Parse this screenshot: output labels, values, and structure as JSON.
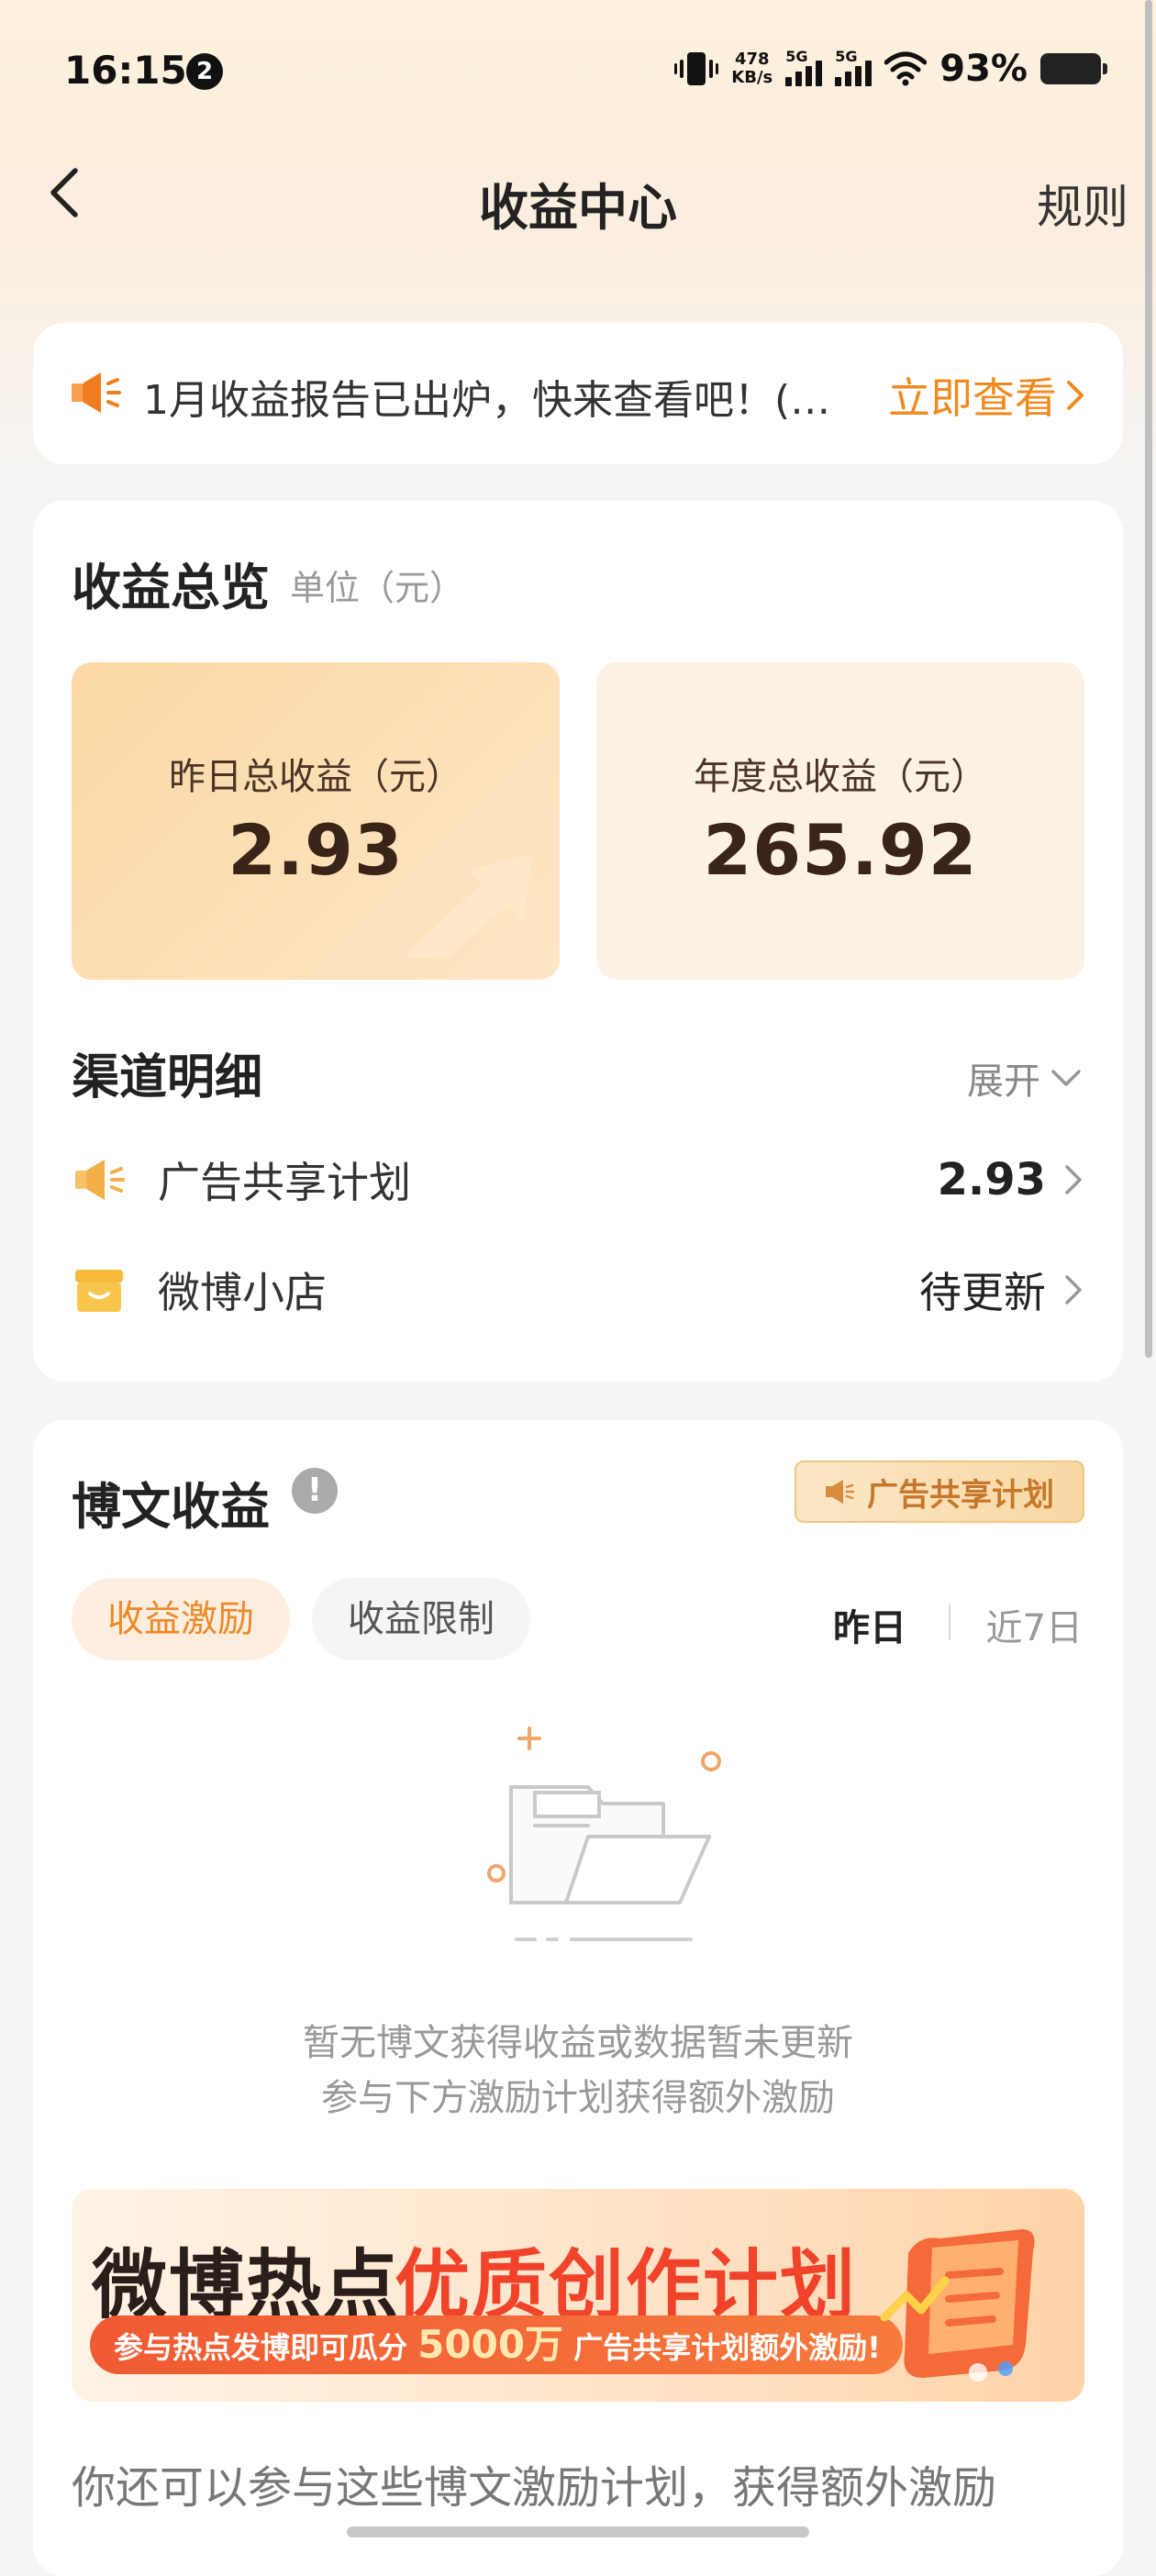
{
  "status_bar": {
    "time": "16:15",
    "notification_count": "2",
    "net_speed_value": "478",
    "net_speed_unit": "KB/s",
    "sim1_label": "5G",
    "sim2_label": "5G",
    "battery": "93%"
  },
  "nav": {
    "title": "收益中心",
    "rules": "规则"
  },
  "notice": {
    "text": "1月收益报告已出炉，快来查看吧！(…",
    "link": "立即查看"
  },
  "overview": {
    "title": "收益总览",
    "unit": "单位（元）",
    "stats": [
      {
        "label": "昨日总收益（元）",
        "value": "2.93"
      },
      {
        "label": "年度总收益（元）",
        "value": "265.92"
      }
    ],
    "channels_title": "渠道明细",
    "expand": "展开",
    "channels": [
      {
        "name": "广告共享计划",
        "value": "2.93"
      },
      {
        "name": "微博小店",
        "value": "待更新"
      }
    ]
  },
  "posts": {
    "title": "博文收益",
    "badge": "广告共享计划",
    "tabs": [
      "收益激励",
      "收益限制"
    ],
    "ranges": [
      "昨日",
      "近7日"
    ],
    "empty_line1": "暂无博文获得收益或数据暂未更新",
    "empty_line2": "参与下方激励计划获得额外激励",
    "banner": {
      "title_dark": "微博热点",
      "title_red": "优质创作计划",
      "sub_pre": "参与热点发博即可瓜分",
      "sub_big": "5000万",
      "sub_post": "广告共享计划额外激励!"
    },
    "more_text": "你还可以参与这些博文激励计划，获得额外激励"
  },
  "colors": {
    "accent": "#f08a1e",
    "banner_red": "#f0432a"
  }
}
